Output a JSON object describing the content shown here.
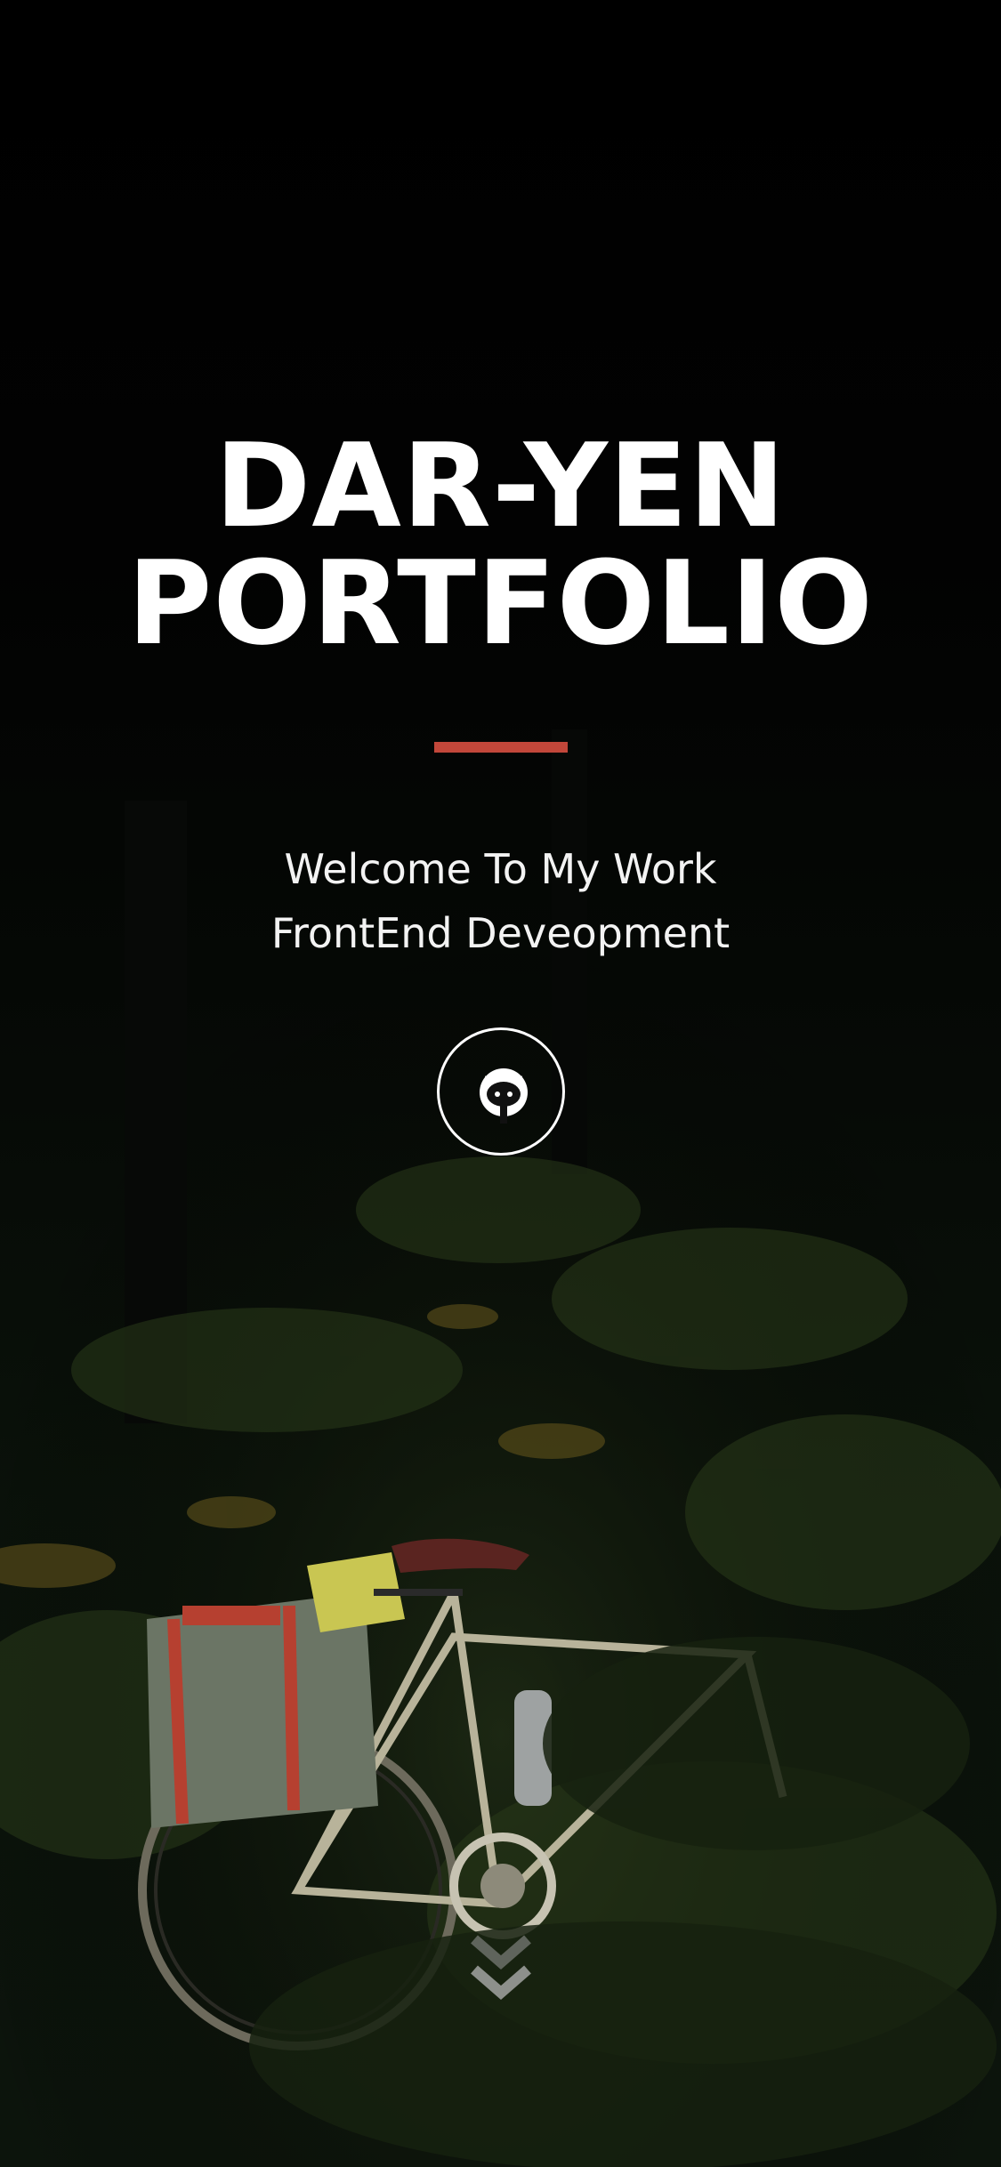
{
  "hero": {
    "title_line1": "DAR-YEN",
    "title_line2": "PORTFOLIO",
    "subtitle_line1": "Welcome To My Work",
    "subtitle_line2": "FrontEnd Deveopment"
  },
  "icons": {
    "github": "github-octocat-icon",
    "scroll": "double-chevron-down-icon"
  },
  "colors": {
    "accent": "#c2473a",
    "text": "#ffffff",
    "background": "#000000"
  }
}
